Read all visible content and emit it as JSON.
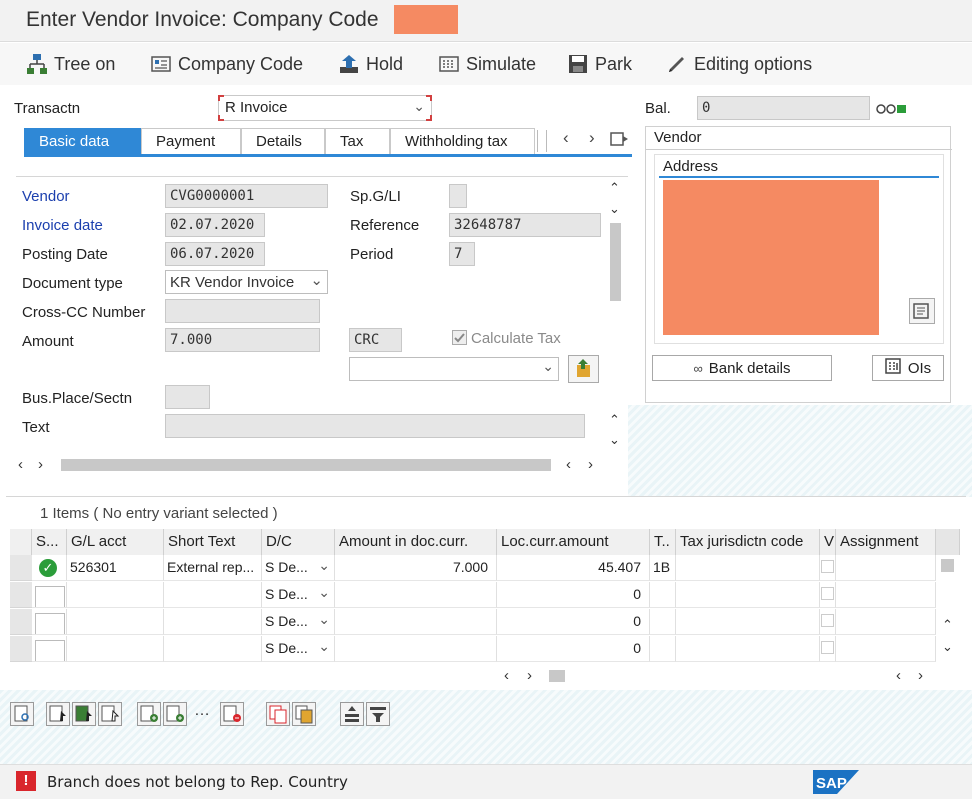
{
  "window": {
    "title": "Enter Vendor Invoice: Company Code"
  },
  "toolbar": {
    "tree_on": "Tree on",
    "company_code": "Company Code",
    "hold": "Hold",
    "simulate": "Simulate",
    "park": "Park",
    "editing_options": "Editing options"
  },
  "header": {
    "transaction_label": "Transactn",
    "transaction_value": "R Invoice",
    "balance_label": "Bal.",
    "balance_value": "0"
  },
  "tabs": [
    "Basic data",
    "Payment",
    "Details",
    "Tax",
    "Withholding tax"
  ],
  "basic": {
    "vendor_label": "Vendor",
    "vendor_value": "CVG0000001",
    "spgl_label": "Sp.G/LI",
    "spgl_value": "",
    "invoice_date_label": "Invoice date",
    "invoice_date_value": "02.07.2020",
    "reference_label": "Reference",
    "reference_value": "32648787",
    "posting_date_label": "Posting Date",
    "posting_date_value": "06.07.2020",
    "period_label": "Period",
    "period_value": "7",
    "doc_type_label": "Document type",
    "doc_type_value": "KR Vendor Invoice",
    "cross_cc_label": "Cross-CC Number",
    "cross_cc_value": "",
    "amount_label": "Amount",
    "amount_value": "7.000",
    "currency_value": "CRC",
    "calc_tax_label": "Calculate Tax",
    "calc_tax_checked": true,
    "tax_code_value": "",
    "bus_place_label": "Bus.Place/Sectn",
    "bus_place_value": "",
    "text_label": "Text",
    "text_value": ""
  },
  "vendor_panel": {
    "title": "Vendor",
    "address_label": "Address",
    "bank_details": "Bank details",
    "ois": "OIs"
  },
  "items": {
    "caption": "1 Items ( No entry variant selected )",
    "columns": [
      "S...",
      "G/L acct",
      "Short Text",
      "D/C",
      "Amount in doc.curr.",
      "Loc.curr.amount",
      "T..",
      "Tax jurisdictn code",
      "V",
      "Assignment"
    ],
    "rows": [
      {
        "gl": "526301",
        "short_text": "External rep...",
        "dc": "S De...",
        "amount": "7.000",
        "loc_amount": "45.407",
        "tax": "1B"
      },
      {
        "gl": "",
        "short_text": "",
        "dc": "S De...",
        "amount": "",
        "loc_amount": "0",
        "tax": ""
      },
      {
        "gl": "",
        "short_text": "",
        "dc": "S De...",
        "amount": "",
        "loc_amount": "0",
        "tax": ""
      },
      {
        "gl": "",
        "short_text": "",
        "dc": "S De...",
        "amount": "",
        "loc_amount": "0",
        "tax": ""
      }
    ]
  },
  "status": {
    "message": "Branch does not belong to Rep. Country",
    "logo": "SAP"
  },
  "colors": {
    "accent": "#2f88d6",
    "redaction": "#f58a62",
    "error": "#d9262c",
    "ok": "#2b9d3a"
  }
}
